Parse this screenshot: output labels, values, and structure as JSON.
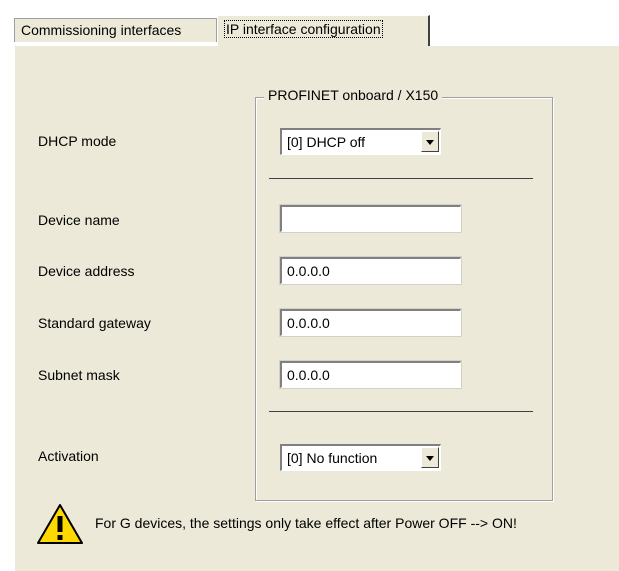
{
  "tabs": [
    {
      "label": "Commissioning interfaces"
    },
    {
      "label": "IP interface configuration"
    }
  ],
  "group": {
    "title": "PROFINET onboard / X150"
  },
  "fields": {
    "dhcp_mode": {
      "label": "DHCP mode",
      "value": "[0] DHCP off"
    },
    "device_name": {
      "label": "Device name",
      "value": ""
    },
    "device_address": {
      "label": "Device address",
      "value": "0.0.0.0"
    },
    "standard_gateway": {
      "label": "Standard gateway",
      "value": "0.0.0.0"
    },
    "subnet_mask": {
      "label": "Subnet mask",
      "value": "0.0.0.0"
    },
    "activation": {
      "label": "Activation",
      "value": "[0] No function"
    }
  },
  "warning": {
    "icon": "warning-triangle-icon",
    "text": "For G devices, the settings only take effect after Power OFF --> ON!"
  },
  "colors": {
    "panel_bg": "#ECE9D8",
    "warning_yellow": "#FFD800"
  }
}
